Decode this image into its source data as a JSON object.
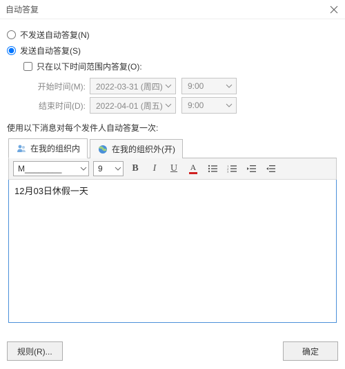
{
  "window": {
    "title": "自动答复"
  },
  "radios": {
    "off_label": "不发送自动答复(N)",
    "on_label": "发送自动答复(S)",
    "selected": "on"
  },
  "timerange": {
    "checkbox_label": "只在以下时间范围内答复(O):",
    "start_label": "开始时间(M):",
    "start_date": "2022-03-31 (周四)",
    "start_time": "9:00",
    "end_label": "结束时间(D):",
    "end_date": "2022-04-01 (周五)",
    "end_time": "9:00"
  },
  "section_label": "使用以下消息对每个发件人自动答复一次:",
  "tabs": {
    "inside": "在我的组织内",
    "outside": "在我的组织外(开)"
  },
  "toolbar": {
    "font": "M________",
    "size": "9"
  },
  "editor": {
    "value": "12月03日休假一天"
  },
  "footer": {
    "rules": "规则(R)...",
    "ok": "确定"
  }
}
